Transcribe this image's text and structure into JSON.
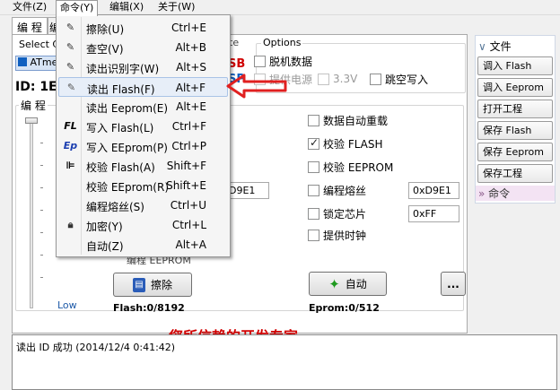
{
  "menubar": [
    {
      "label": "文件(Z)"
    },
    {
      "label": "命令(Y)"
    },
    {
      "label": "编辑(X)"
    },
    {
      "label": "关于(W)"
    }
  ],
  "tabs": [
    "编 程",
    "编"
  ],
  "chip": {
    "select_label": "Select Ch",
    "chip_name": "ATme",
    "id_label": "ID:",
    "id_value": "1E",
    "usb_label": "SB",
    "sp_label": "SP",
    "ite_fragment": "ite"
  },
  "options": {
    "title": "Options",
    "offline": "脱机数据",
    "power": "提供电源",
    "v33": "3.3V",
    "skip": "跳空写入"
  },
  "program": {
    "title": "编 程",
    "auto_reload": "数据自动重载",
    "verify_flash": "校验 FLASH",
    "verify_eeprom": "校验 EEPROM",
    "prog_fuse": "编程熔丝",
    "fuse_value_left": "D9E1",
    "fuse_value": "0xD9E1",
    "lock_chip": "锁定芯片",
    "lock_value": "0xFF",
    "clock": "提供时钟",
    "prog_eeprom_hidden": "编程 EEPROM",
    "low": "Low"
  },
  "buttons": {
    "erase": "擦除",
    "auto": "自动",
    "more": "..."
  },
  "status": {
    "flash": "Flash:0/8192",
    "eeprom": "Eprom:0/512"
  },
  "banner": "您所信赖的开发专家",
  "right_panel": {
    "file_header": "文件",
    "file_buttons": [
      "调入 Flash",
      "调入 Eeprom",
      "打开工程",
      "保存 Flash",
      "保存 Eeprom",
      "保存工程"
    ],
    "cmd_header": "命令"
  },
  "log": "读出 ID 成功 (2014/12/4 0:41:42)",
  "dropdown": [
    {
      "label": "擦除(U)",
      "shortcut": "Ctrl+E",
      "icon": "eraser-icon"
    },
    {
      "label": "查空(V)",
      "shortcut": "Alt+B",
      "icon": "blank-check-icon"
    },
    {
      "label": "读出识别字(W)",
      "shortcut": "Alt+S",
      "icon": "read-id-icon"
    },
    {
      "label": "读出 Flash(F)",
      "shortcut": "Alt+F",
      "icon": "read-flash-icon"
    },
    {
      "label": "读出 Eeprom(E)",
      "shortcut": "Alt+E",
      "icon": ""
    },
    {
      "label": "写入 Flash(L)",
      "shortcut": "Ctrl+F",
      "icon": "write-flash-icon",
      "icon_text": "FL"
    },
    {
      "label": "写入 EEprom(P)",
      "shortcut": "Ctrl+P",
      "icon": "write-eeprom-icon",
      "icon_text": "Ep"
    },
    {
      "label": "校验 Flash(A)",
      "shortcut": "Shift+F",
      "icon": "verify-flash-icon"
    },
    {
      "label": "校验 EEprom(R)",
      "shortcut": "Shift+E",
      "icon": ""
    },
    {
      "label": "编程熔丝(S)",
      "shortcut": "Ctrl+U",
      "icon": ""
    },
    {
      "label": "加密(Y)",
      "shortcut": "Ctrl+L",
      "icon": "lock-icon"
    },
    {
      "label": "自动(Z)",
      "shortcut": "Alt+A",
      "icon": ""
    }
  ],
  "colors": {
    "highlight_arrow": "#e02020",
    "banner": "#d00000",
    "accent": "#1060c0"
  }
}
